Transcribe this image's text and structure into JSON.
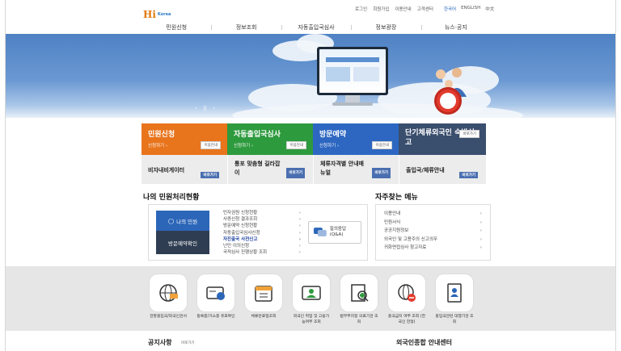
{
  "logo": {
    "hi": "Hi",
    "korea": "Korea"
  },
  "utility": {
    "items": [
      "로그인",
      "회원가입",
      "이용안내",
      "고객센터"
    ],
    "langs": [
      "한국어",
      "ENGLISH",
      "中文"
    ]
  },
  "gnb": [
    "민원신청",
    "정보조회",
    "자동출입국심사",
    "정보광장",
    "뉴스·공지"
  ],
  "hero": {
    "controls": [
      "‹",
      "||",
      "›"
    ]
  },
  "tiles_top": [
    {
      "title": "민원신청",
      "sub": "신청하기 ›",
      "btn": "이용안내",
      "color": "#e8741c"
    },
    {
      "title": "자동출입국심사",
      "sub": "신청하기 ›",
      "btn": "이용안내",
      "color": "#2e9a3e"
    },
    {
      "title": "방문예약",
      "sub": "신청하기 ›",
      "btn": "이용안내",
      "color": "#2d67c2"
    },
    {
      "title": "단기체류외국인 숙박신고",
      "sub": "",
      "btn": "바로가기",
      "color": "#3a4e6e"
    }
  ],
  "tiles_bottom": [
    {
      "title": "비자내비게이터",
      "btn": "바로가기"
    },
    {
      "title": "통포 맞춤형 길라잡이",
      "btn": "바로가기"
    },
    {
      "title": "체류자격별 안내매뉴얼",
      "btn": "바로가기"
    },
    {
      "title": "출입국/체류안내",
      "btn": "바로가기"
    }
  ],
  "status": {
    "title": "나의 민원처리현황",
    "my_btn": "나의 민원",
    "visit_btn": "방문예약확인",
    "list": [
      "민자권원 신청현황",
      "사증신청 결과조회",
      "방문예약 신청현황",
      "자동출입국심사신청",
      "자진출국 사전신고",
      "난민 이의신청",
      "국적심사 진행상황 조회"
    ],
    "highlight_index": 4,
    "qna": "질의응답 (Q&A)"
  },
  "freq": {
    "title": "자주찾는 메뉴",
    "items": [
      "이용안내",
      "민원서식",
      "공공지원정보",
      "외국인 및 고용주의 신고의무",
      "귀화면접심사 참고자료"
    ]
  },
  "services": [
    {
      "label": "관할출입국/외국인관서",
      "icon": "globe-icon"
    },
    {
      "label": "등록증/거소증 유효확인",
      "icon": "card-icon"
    },
    {
      "label": "체류만료일조회",
      "icon": "calendar-icon"
    },
    {
      "label": "외국인 취업 및 고용가능여부 조회",
      "icon": "worker-icon"
    },
    {
      "label": "법무부지정 의료기관 조회",
      "icon": "medical-icon"
    },
    {
      "label": "출국금지 여부 조회 (한국인 한정)",
      "icon": "travel-ban-icon"
    },
    {
      "label": "출입국관련 대행기관 조회",
      "icon": "agency-icon"
    }
  ],
  "notice": {
    "title": "공지사항",
    "more": "바로가기"
  },
  "center": {
    "title": "외국인종합 안내센터"
  }
}
